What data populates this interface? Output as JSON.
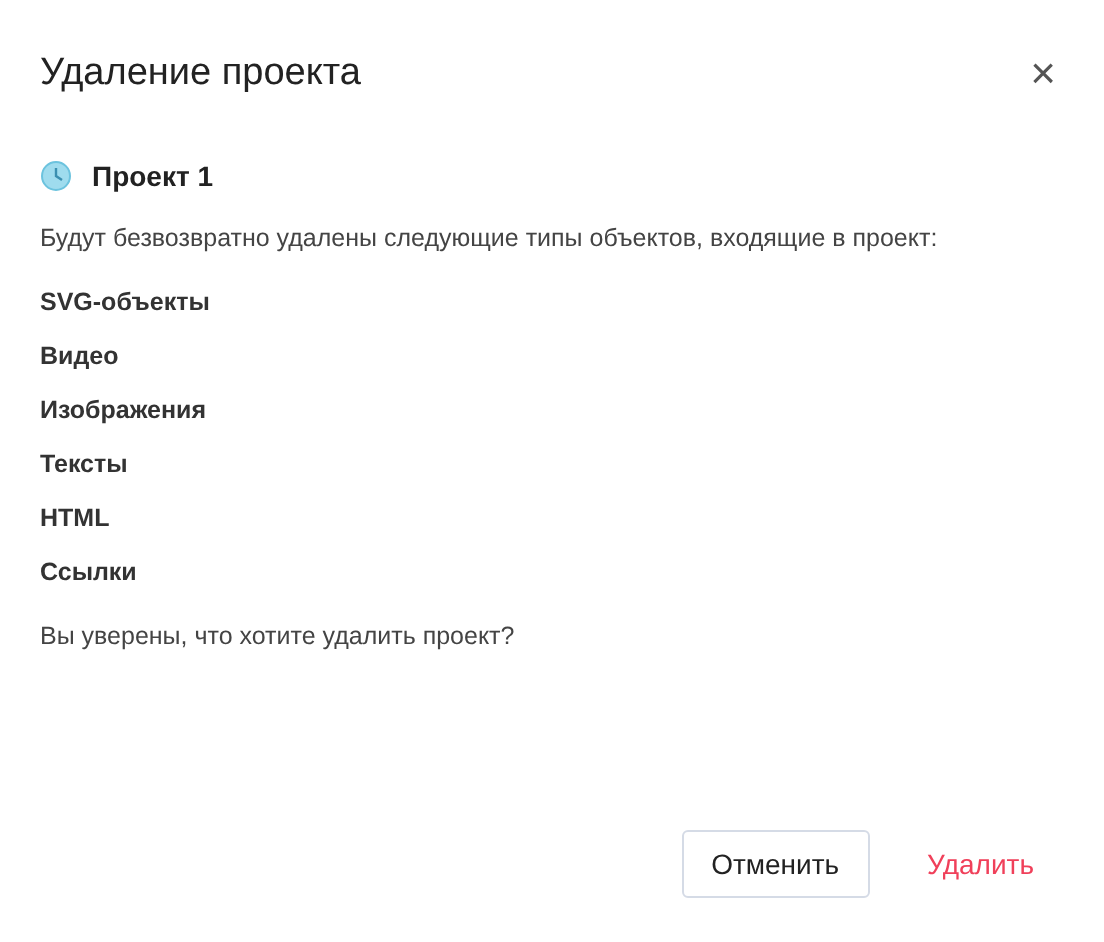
{
  "dialog": {
    "title": "Удаление проекта",
    "close": "×"
  },
  "project": {
    "name": "Проект 1"
  },
  "description": "Будут безвозвратно удалены следующие типы объектов, входящие в проект:",
  "object_types": [
    "SVG-объекты",
    "Видео",
    "Изображения",
    "Тексты",
    "HTML",
    "Ссылки"
  ],
  "question": "Вы уверены, что хотите удалить проект?",
  "buttons": [
    {
      "label": "Отменить",
      "kind": "secondary"
    },
    {
      "label": "Удалить",
      "kind": "danger"
    }
  ]
}
